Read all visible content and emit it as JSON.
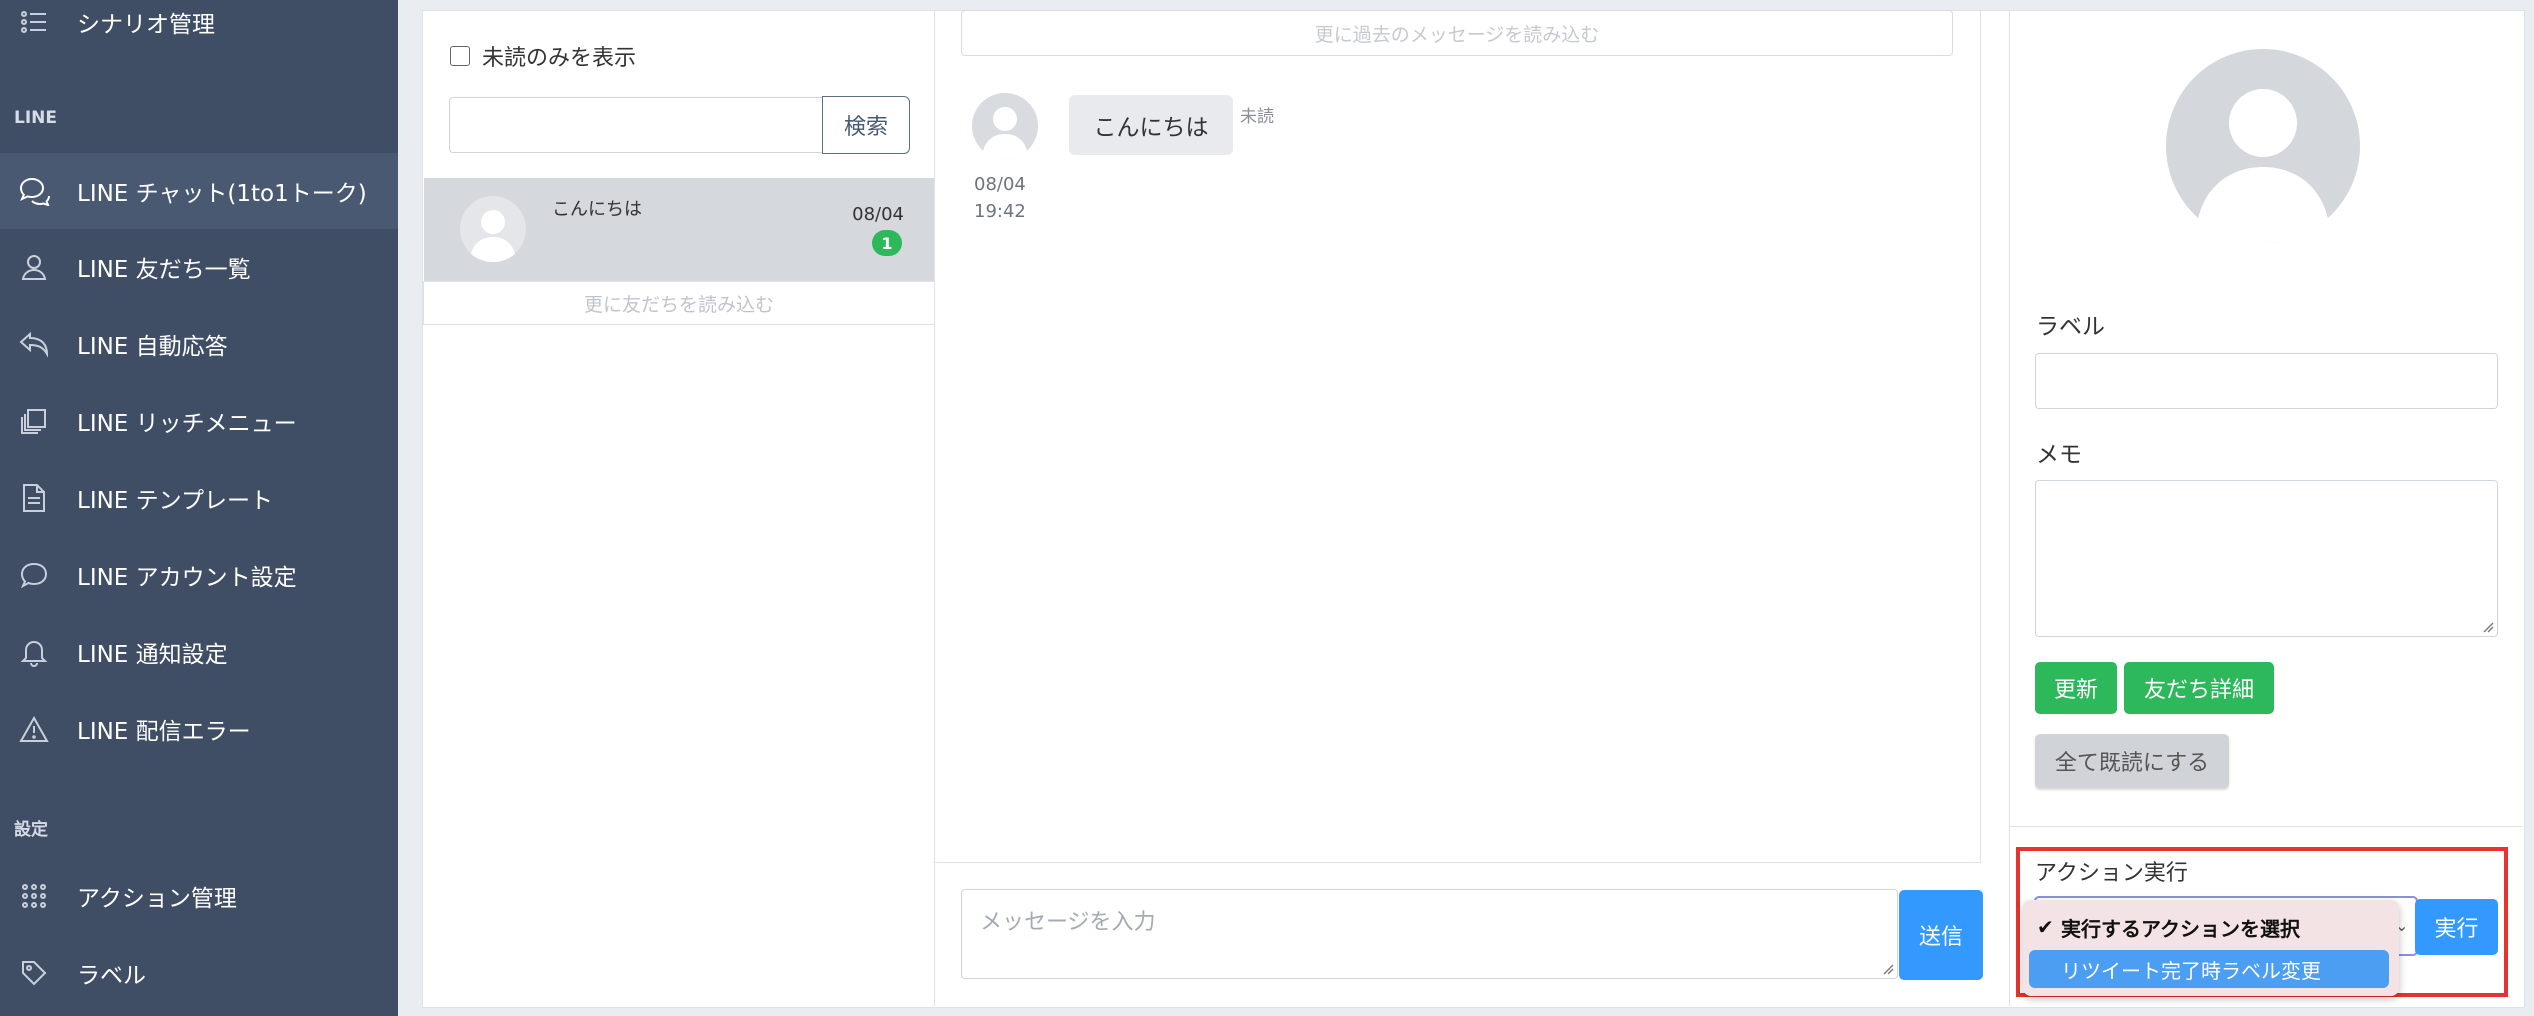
{
  "sidebar": {
    "scenario_label": "シナリオ管理",
    "line_section": "LINE",
    "settings_section": "設定",
    "items": [
      {
        "label": "LINE チャット(1to1トーク)",
        "icon": "chat-icon"
      },
      {
        "label": "LINE 友だち一覧",
        "icon": "user-icon"
      },
      {
        "label": "LINE 自動応答",
        "icon": "reply-icon"
      },
      {
        "label": "LINE リッチメニュー",
        "icon": "layers-icon"
      },
      {
        "label": "LINE テンプレート",
        "icon": "document-icon"
      },
      {
        "label": "LINE アカウント設定",
        "icon": "speech-bubble-icon"
      },
      {
        "label": "LINE 通知設定",
        "icon": "bell-icon"
      },
      {
        "label": "LINE 配信エラー",
        "icon": "warning-icon"
      }
    ],
    "action_label": "アクション管理",
    "label_label": "ラベル"
  },
  "friends": {
    "unread_only": "未読のみを表示",
    "search_button": "検索",
    "list": [
      {
        "message": "こんにちは",
        "date": "08/04",
        "unread": "1"
      }
    ],
    "load_more": "更に友だちを読み込む"
  },
  "chat": {
    "load_older": "更に過去のメッセージを読み込む",
    "message": {
      "text": "こんにちは",
      "status": "未読",
      "date": "08/04",
      "time": "19:42"
    },
    "input_placeholder": "メッセージを入力",
    "send_button": "送信"
  },
  "profile": {
    "label_title": "ラベル",
    "memo_title": "メモ",
    "update_button": "更新",
    "friend_detail_button": "友だち詳細",
    "mark_all_read_button": "全て既読にする",
    "action_title": "アクション実行",
    "action_options": [
      "実行するアクションを選択",
      "リツイート完了時ラベル変更"
    ],
    "run_button": "実行"
  },
  "colors": {
    "sidebar": "#3f4d65",
    "primary": "#3399ff",
    "success": "#2eb85c",
    "highlight_border": "#e8332d"
  }
}
